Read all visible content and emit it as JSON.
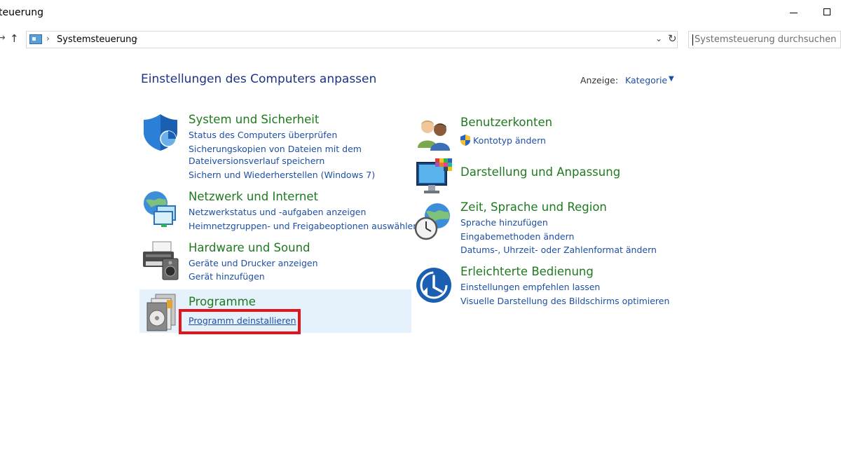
{
  "window": {
    "title": "teuerung"
  },
  "address": {
    "breadcrumb": "Systemsteuerung",
    "search_placeholder": "Systemsteuerung durchsuchen"
  },
  "header": {
    "title": "Einstellungen des Computers anpassen",
    "view_label": "Anzeige:",
    "view_value": "Kategorie"
  },
  "categories": {
    "system": {
      "title": "System und Sicherheit",
      "icon": "shield-icon",
      "links": [
        "Status des Computers überprüfen",
        "Sicherungskopien von Dateien mit dem",
        "Dateiversionsverlauf speichern",
        "Sichern und Wiederherstellen (Windows 7)"
      ]
    },
    "network": {
      "title": "Netzwerk und Internet",
      "icon": "globe-network-icon",
      "links": [
        "Netzwerkstatus und -aufgaben anzeigen",
        "Heimnetzgruppen- und Freigabeoptionen auswählen"
      ]
    },
    "hardware": {
      "title": "Hardware und Sound",
      "icon": "printer-speaker-icon",
      "links": [
        "Geräte und Drucker anzeigen",
        "Gerät hinzufügen"
      ]
    },
    "programs": {
      "title": "Programme",
      "icon": "programs-disc-icon",
      "links": [
        "Programm deinstallieren"
      ]
    },
    "accounts": {
      "title": "Benutzerkonten",
      "icon": "users-icon",
      "links": [
        "Kontotyp ändern"
      ]
    },
    "appearance": {
      "title": "Darstellung und Anpassung",
      "icon": "monitor-palette-icon",
      "links": []
    },
    "region": {
      "title": "Zeit, Sprache und Region",
      "icon": "clock-globe-icon",
      "links": [
        "Sprache hinzufügen",
        "Eingabemethoden ändern",
        "Datums-, Uhrzeit- oder Zahlenformat ändern"
      ]
    },
    "access": {
      "title": "Erleichterte Bedienung",
      "icon": "ease-of-access-icon",
      "links": [
        "Einstellungen empfehlen lassen",
        "Visuelle Darstellung des Bildschirms optimieren"
      ]
    }
  },
  "colors": {
    "category_title": "#1f7a1f",
    "link": "#1e4fa3",
    "header": "#1e3287",
    "highlight": "#e5f1fb",
    "annotation": "#e3141b"
  }
}
